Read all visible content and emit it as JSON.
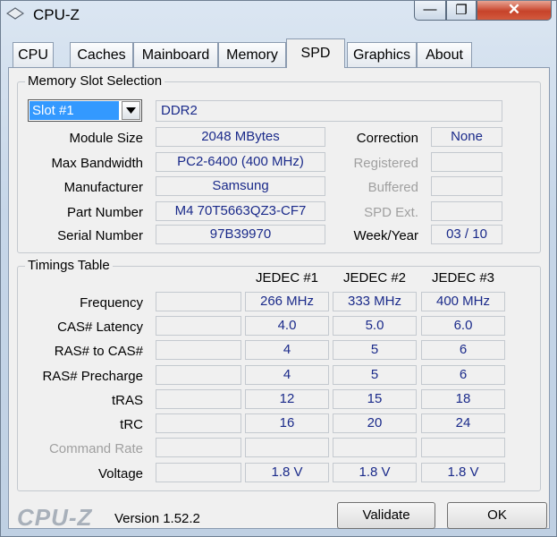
{
  "window": {
    "title": "CPU-Z",
    "close_glyph": "✕",
    "min_glyph": "—",
    "max_glyph": "❐"
  },
  "tabs": [
    "CPU",
    "Caches",
    "Mainboard",
    "Memory",
    "SPD",
    "Graphics",
    "About"
  ],
  "active_tab": "SPD",
  "slot": {
    "group_title": "Memory Slot Selection",
    "selected": "Slot #1",
    "type": "DDR2",
    "labels": {
      "module_size": "Module Size",
      "max_bandwidth": "Max Bandwidth",
      "manufacturer": "Manufacturer",
      "part_number": "Part Number",
      "serial_number": "Serial Number",
      "correction": "Correction",
      "registered": "Registered",
      "buffered": "Buffered",
      "spd_ext": "SPD Ext.",
      "week_year": "Week/Year"
    },
    "values": {
      "module_size": "2048 MBytes",
      "max_bandwidth": "PC2-6400 (400 MHz)",
      "manufacturer": "Samsung",
      "part_number": "M4 70T5663QZ3-CF7",
      "serial_number": "97B39970",
      "correction": "None",
      "registered": "",
      "buffered": "",
      "spd_ext": "",
      "week_year": "03 / 10"
    }
  },
  "timings": {
    "group_title": "Timings Table",
    "columns": [
      "JEDEC #1",
      "JEDEC #2",
      "JEDEC #3"
    ],
    "rows": [
      {
        "label": "Frequency",
        "values": [
          "266 MHz",
          "333 MHz",
          "400 MHz"
        ]
      },
      {
        "label": "CAS# Latency",
        "values": [
          "4.0",
          "5.0",
          "6.0"
        ]
      },
      {
        "label": "RAS# to CAS#",
        "values": [
          "4",
          "5",
          "6"
        ]
      },
      {
        "label": "RAS# Precharge",
        "values": [
          "4",
          "5",
          "6"
        ]
      },
      {
        "label": "tRAS",
        "values": [
          "12",
          "15",
          "18"
        ]
      },
      {
        "label": "tRC",
        "values": [
          "16",
          "20",
          "24"
        ]
      },
      {
        "label": "Command Rate",
        "values": [
          "",
          "",
          ""
        ]
      },
      {
        "label": "Voltage",
        "values": [
          "1.8 V",
          "1.8 V",
          "1.8 V"
        ]
      }
    ]
  },
  "footer": {
    "logo": "CPU-Z",
    "version": "Version 1.52.2",
    "validate_label": "Validate",
    "ok_label": "OK"
  },
  "colors": {
    "value_text": "#1a2a8a",
    "selection": "#3399ff",
    "disabled": "#a0a0a0"
  }
}
